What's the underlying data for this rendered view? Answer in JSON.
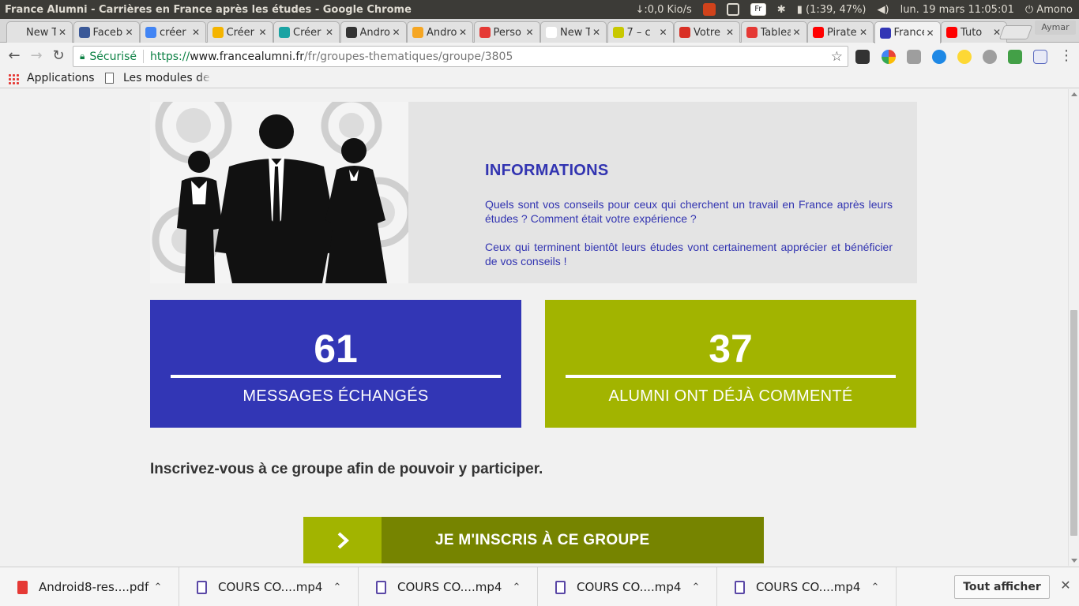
{
  "os_bar": {
    "window_title": "France Alumni - Carrières en France après les études - Google Chrome",
    "network": "↓:0,0 Kio/s",
    "keyboard_layout": "Fr",
    "battery": "(1:39, 47%)",
    "clock": "lun. 19 mars 11:05:01",
    "user": "Amono"
  },
  "tabs": [
    {
      "label": "New Tab",
      "favicon_color": "#e2e2e2"
    },
    {
      "label": "Facebook",
      "favicon_color": "#3b5998"
    },
    {
      "label": "créer",
      "favicon_color": "#4285f4"
    },
    {
      "label": "Créer",
      "favicon_color": "#f4b400"
    },
    {
      "label": "Créer",
      "favicon_color": "#1aa3a3"
    },
    {
      "label": "Android",
      "favicon_color": "#333333"
    },
    {
      "label": "Android",
      "favicon_color": "#f5a623"
    },
    {
      "label": "Perso",
      "favicon_color": "#e53935"
    },
    {
      "label": "New Tab",
      "favicon_color": "#ffffff"
    },
    {
      "label": "7 – c",
      "favicon_color": "#c8c800"
    },
    {
      "label": "Votre",
      "favicon_color": "#d93025"
    },
    {
      "label": "Tableau",
      "favicon_color": "#e53935"
    },
    {
      "label": "Pirate",
      "favicon_color": "#ff0000"
    },
    {
      "label": "France",
      "favicon_color": "#3236b5"
    },
    {
      "label": "Tuto",
      "favicon_color": "#ff0000"
    }
  ],
  "active_tab_index": 13,
  "profile_name": "Aymar",
  "address_bar": {
    "secure_label": "Sécurisé",
    "scheme": "https://",
    "host": "www.francealumni.fr",
    "path": "/fr/groupes-thematiques/groupe/3805"
  },
  "bookmarks": {
    "apps_label": "Applications",
    "item": "Les modules de formation"
  },
  "page": {
    "info_title": "INFORMATIONS",
    "info_paragraph_1": "Quels sont vos conseils pour ceux qui cherchent un travail en France après leurs études ? Comment était votre expérience ?",
    "info_paragraph_2": "Ceux qui terminent bientôt leurs études vont certainement apprécier et bénéficier de vos conseils !",
    "stats": {
      "messages_count": "61",
      "messages_label": "MESSAGES ÉCHANGÉS",
      "alumni_count": "37",
      "alumni_label": "ALUMNI ONT DÉJÀ COMMENTÉ"
    },
    "signup_prompt": "Inscrivez-vous à ce groupe afin de pouvoir y participer.",
    "join_button": "JE M'INSCRIS À CE GROUPE",
    "colors": {
      "brand_blue": "#3236b5",
      "brand_green": "#a2b400",
      "brand_green_dark": "#768400"
    }
  },
  "downloads": [
    {
      "name": "Android8-res....pdf",
      "type": "pdf"
    },
    {
      "name": "COURS CO....mp4",
      "type": "video"
    },
    {
      "name": "COURS CO....mp4",
      "type": "video"
    },
    {
      "name": "COURS CO....mp4",
      "type": "video"
    },
    {
      "name": "COURS CO....mp4",
      "type": "video"
    }
  ],
  "downloads_show_all": "Tout afficher"
}
